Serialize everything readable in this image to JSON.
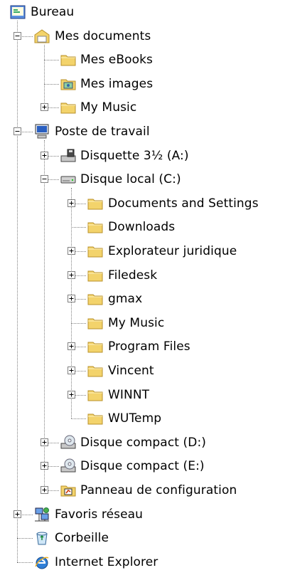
{
  "tree": {
    "root": {
      "label": "Bureau",
      "icon": "desktop-icon"
    },
    "items": [
      {
        "label": "Mes documents",
        "icon": "my-documents-icon",
        "expander": "minus"
      },
      {
        "label": "Mes eBooks",
        "icon": "folder-icon",
        "expander": "none"
      },
      {
        "label": "Mes images",
        "icon": "pictures-folder-icon",
        "expander": "none"
      },
      {
        "label": "My Music",
        "icon": "folder-icon",
        "expander": "plus"
      },
      {
        "label": "Poste de travail",
        "icon": "my-computer-icon",
        "expander": "minus"
      },
      {
        "label": "Disquette 3½ (A:)",
        "icon": "floppy-drive-icon",
        "expander": "plus"
      },
      {
        "label": "Disque local (C:)",
        "icon": "hard-drive-icon",
        "expander": "minus"
      },
      {
        "label": "Documents and Settings",
        "icon": "folder-icon",
        "expander": "plus"
      },
      {
        "label": "Downloads",
        "icon": "folder-icon",
        "expander": "none"
      },
      {
        "label": "Explorateur juridique",
        "icon": "folder-icon",
        "expander": "plus"
      },
      {
        "label": "Filedesk",
        "icon": "folder-icon",
        "expander": "plus"
      },
      {
        "label": "gmax",
        "icon": "folder-icon",
        "expander": "plus"
      },
      {
        "label": "My Music",
        "icon": "folder-icon",
        "expander": "none"
      },
      {
        "label": "Program Files",
        "icon": "folder-icon",
        "expander": "plus"
      },
      {
        "label": "Vincent",
        "icon": "folder-icon",
        "expander": "plus"
      },
      {
        "label": "WINNT",
        "icon": "folder-icon",
        "expander": "plus"
      },
      {
        "label": "WUTemp",
        "icon": "folder-icon",
        "expander": "none"
      },
      {
        "label": "Disque compact (D:)",
        "icon": "cd-drive-icon",
        "expander": "plus"
      },
      {
        "label": "Disque compact (E:)",
        "icon": "cd-drive-icon",
        "expander": "plus"
      },
      {
        "label": "Panneau de configuration",
        "icon": "control-panel-icon",
        "expander": "plus"
      },
      {
        "label": "Favoris réseau",
        "icon": "network-places-icon",
        "expander": "plus"
      },
      {
        "label": "Corbeille",
        "icon": "recycle-bin-icon",
        "expander": "none"
      },
      {
        "label": "Internet Explorer",
        "icon": "internet-explorer-icon",
        "expander": "none"
      }
    ]
  },
  "colors": {
    "folder": "#f3d36b",
    "folder_edge": "#b8912b",
    "tree_line": "#808080"
  }
}
